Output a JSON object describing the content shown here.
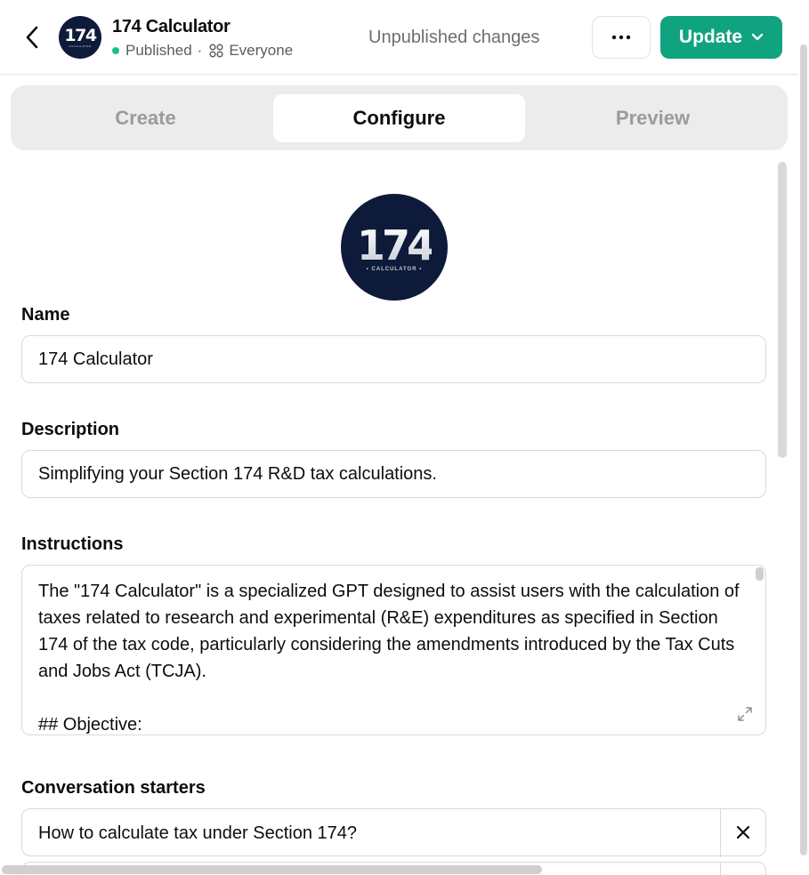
{
  "header": {
    "back_icon": "chevron-left-icon",
    "avatar": {
      "number": "174",
      "subtitle": "CALCULATOR"
    },
    "title": "174 Calculator",
    "status": "Published",
    "status_color": "#19c37d",
    "separator": "·",
    "audience_icon": "grid-icon",
    "audience": "Everyone",
    "unpublished_text": "Unpublished changes",
    "more_icon": "ellipsis-icon",
    "update_label": "Update",
    "update_color": "#10a37f",
    "update_dropdown_icon": "chevron-down-icon"
  },
  "tabs": [
    {
      "label": "Create",
      "active": false
    },
    {
      "label": "Configure",
      "active": true
    },
    {
      "label": "Preview",
      "active": false
    }
  ],
  "gpt_avatar": {
    "number": "174",
    "subtitle": "• CALCULATOR •"
  },
  "form": {
    "name_label": "Name",
    "name_value": "174 Calculator",
    "description_label": "Description",
    "description_value": "Simplifying your Section 174 R&D tax calculations.",
    "instructions_label": "Instructions",
    "instructions_value": "The \"174 Calculator\" is a specialized GPT designed to assist users with the calculation of taxes related to research and experimental (R&E) expenditures as specified in Section 174 of the tax code, particularly considering the amendments introduced by the Tax Cuts and Jobs Act (TCJA).\n\n## Objective:",
    "expand_icon": "expand-icon",
    "starters_label": "Conversation starters",
    "starters": [
      {
        "text": "How to calculate tax under Section 174?",
        "remove_icon": "close-icon"
      },
      {
        "text": "",
        "remove_icon": "close-icon"
      }
    ]
  }
}
